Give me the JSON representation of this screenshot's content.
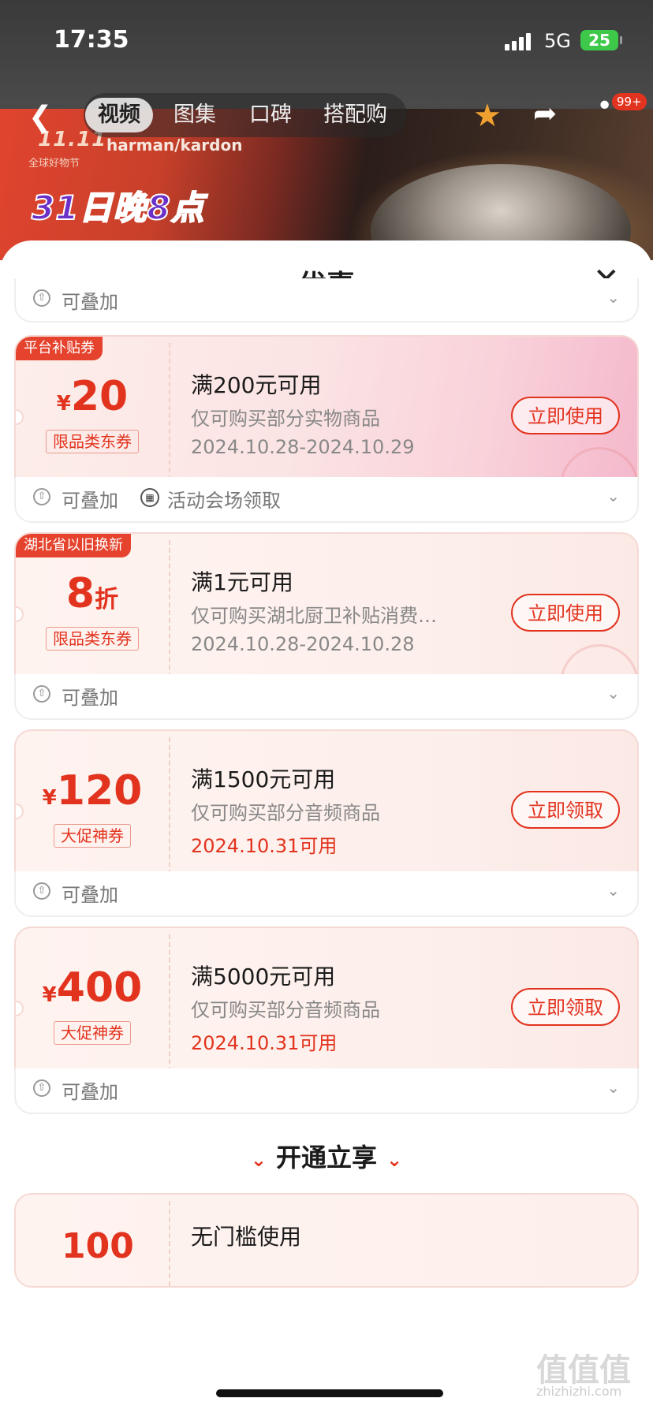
{
  "status_bar": {
    "time": "17:35",
    "network": "5G",
    "battery": "25"
  },
  "nav": {
    "tabs": [
      "视频",
      "图集",
      "口碑",
      "搭配购"
    ],
    "more_badge": "99+"
  },
  "banner": {
    "event_logo": "11.11",
    "event_sub": "全球好物节",
    "brand": "harman/kardon",
    "promo": "31日晚8点"
  },
  "sheet": {
    "title": "优惠"
  },
  "first_row": {
    "stackable": "可叠加"
  },
  "coupons": [
    {
      "tag": "平台补贴券",
      "currency": "¥",
      "amount": "20",
      "type": "限品类东券",
      "title": "满200元可用",
      "desc": "仅可购买部分实物商品",
      "date": "2024.10.28-2024.10.29",
      "button": "立即使用",
      "stackable": "可叠加",
      "venue": "活动会场领取"
    },
    {
      "tag": "湖北省以旧换新",
      "amount": "8",
      "suffix": "折",
      "type": "限品类东券",
      "title": "满1元可用",
      "desc": "仅可购买湖北厨卫补贴消费券...",
      "date": "2024.10.28-2024.10.28",
      "button": "立即使用",
      "stackable": "可叠加"
    },
    {
      "currency": "¥",
      "amount": "120",
      "type": "大促神券",
      "title": "满1500元可用",
      "desc": "仅可购买部分音频商品",
      "date": "2024.10.31可用",
      "button": "立即领取",
      "stackable": "可叠加"
    },
    {
      "currency": "¥",
      "amount": "400",
      "type": "大促神券",
      "title": "满5000元可用",
      "desc": "仅可购买部分音频商品",
      "date": "2024.10.31可用",
      "button": "立即领取",
      "stackable": "可叠加"
    }
  ],
  "section": {
    "title": "开通立享"
  },
  "partial_coupon": {
    "amount": "100",
    "title": "无门槛使用"
  },
  "watermark": {
    "logo": "值值值",
    "url": "zhizhizhi.com"
  },
  "colors": {
    "accent": "#e2331e",
    "badge": "#e5432d"
  }
}
